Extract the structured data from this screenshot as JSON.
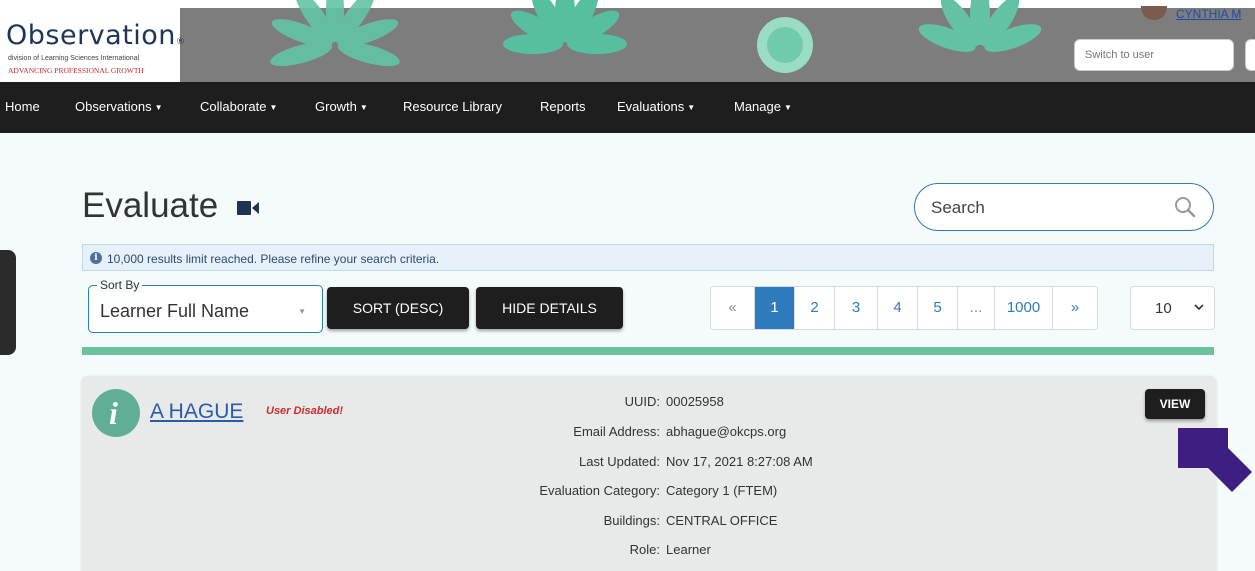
{
  "header": {
    "logo_title": "Observation",
    "logo_registered": "®",
    "logo_subtitle": "division of Learning Sciences International",
    "logo_tagline": "ADVANCING PROFESSIONAL GROWTH",
    "user_name": "CYNTHIA M",
    "switch_user_placeholder": "Switch to user"
  },
  "nav": {
    "items": [
      {
        "label": "Home",
        "dropdown": false
      },
      {
        "label": "Observations",
        "dropdown": true
      },
      {
        "label": "Collaborate",
        "dropdown": true
      },
      {
        "label": "Growth",
        "dropdown": true
      },
      {
        "label": "Resource Library",
        "dropdown": false
      },
      {
        "label": "Reports",
        "dropdown": false
      },
      {
        "label": "Evaluations",
        "dropdown": true
      },
      {
        "label": "Manage",
        "dropdown": true
      }
    ],
    "caret": "▼"
  },
  "main": {
    "title": "Evaluate",
    "search_placeholder": "Search",
    "info_message": "10,000 results limit reached. Please refine your search criteria.",
    "sort_by_label": "Sort By",
    "sort_by_value": "Learner Full Name",
    "sort_button": "SORT (DESC)",
    "hide_details_button": "HIDE DETAILS",
    "pagination": {
      "prev": "«",
      "pages": [
        "1",
        "2",
        "3",
        "4",
        "5"
      ],
      "ellipsis": "...",
      "last": "1000",
      "next": "»",
      "active_page": "1"
    },
    "per_page": "10"
  },
  "record": {
    "name": "A HAGUE",
    "status": "User Disabled!",
    "view_button": "VIEW",
    "details": [
      {
        "label": "UUID:",
        "value": "00025958"
      },
      {
        "label": "Email Address:",
        "value": "abhague@okcps.org"
      },
      {
        "label": "Last Updated:",
        "value": "Nov 17, 2021 8:27:08 AM"
      },
      {
        "label": "Evaluation Category:",
        "value": "Category 1 (FTEM)"
      },
      {
        "label": "Buildings:",
        "value": "CENTRAL OFFICE"
      },
      {
        "label": "Role:",
        "value": "Learner"
      }
    ]
  },
  "colors": {
    "nav_bg": "#1e1e1e",
    "accent_blue": "#2e7bbd",
    "accent_green": "#6cc29f",
    "disabled_red": "#d12b2b",
    "arrow_purple": "#3f1e82"
  }
}
